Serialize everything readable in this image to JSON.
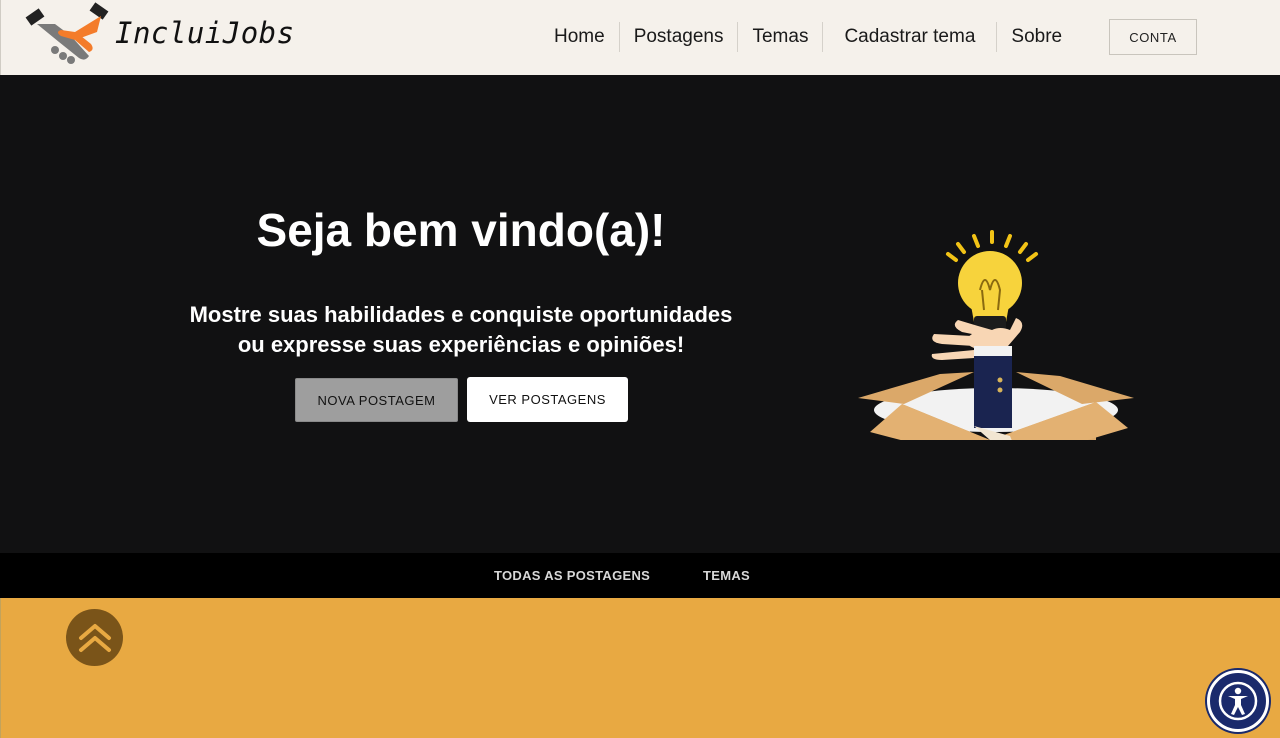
{
  "header": {
    "brand": "IncluiJobs",
    "nav": [
      "Home",
      "Postagens",
      "Temas",
      "Cadastrar tema",
      "Sobre"
    ],
    "account_label": "CONTA"
  },
  "hero": {
    "title": "Seja bem vindo(a)!",
    "subtitle_line1": "Mostre suas habilidades e conquiste oportunidades",
    "subtitle_line2": "ou expresse suas experiências e opiniões!",
    "new_post_label": "NOVA POSTAGEM",
    "view_posts_label": "VER POSTAGENS",
    "illustration_icon": "lightbulb-box-illustration"
  },
  "tabs": {
    "all_posts": "TODAS AS POSTAGENS",
    "themes": "TEMAS"
  },
  "icons": {
    "logo": "handshake-icon",
    "scroll_top": "double-chevron-up-icon",
    "accessibility": "accessibility-icon"
  },
  "colors": {
    "header_bg": "#f5f1eb",
    "hero_bg": "#111112",
    "tabbar_bg": "#000000",
    "content_bg": "#e8a942",
    "accent_orange": "#f47c2a",
    "scroll_btn": "#7a5419",
    "a11y_btn": "#1a2a6c"
  }
}
